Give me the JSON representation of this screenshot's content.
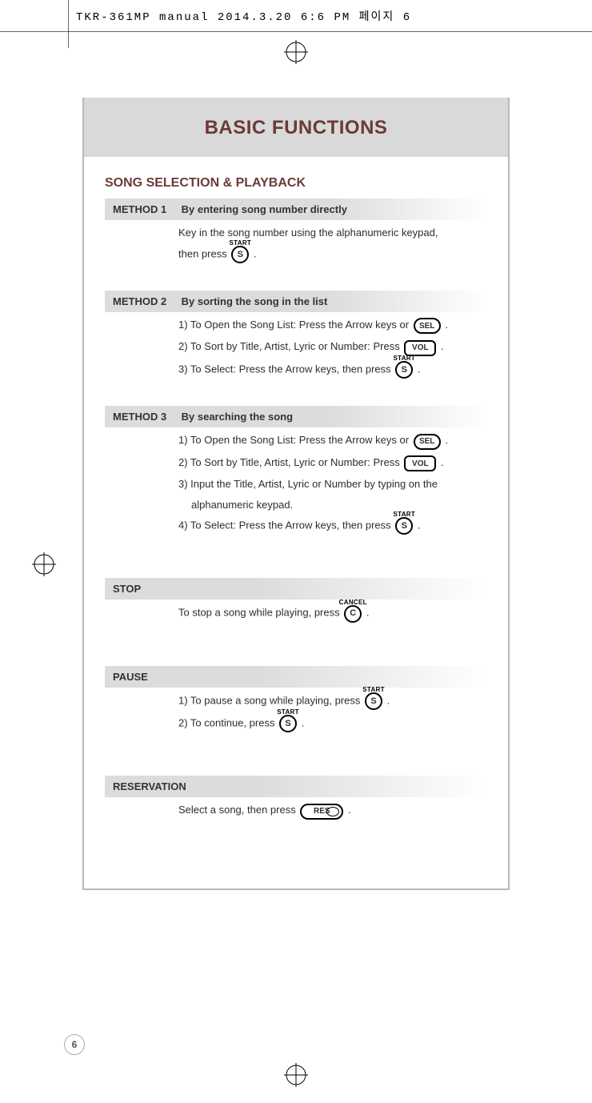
{
  "header": "TKR-361MP manual  2014.3.20  6:6 PM  페이지 6",
  "title": "BASIC FUNCTIONS",
  "section": "SONG SELECTION & PLAYBACK",
  "page_number": "6",
  "buttons": {
    "start": {
      "letter": "S",
      "label": "START"
    },
    "cancel": {
      "letter": "C",
      "label": "CANCEL"
    },
    "sel": "SEL",
    "vol": "VOL",
    "res": "RES"
  },
  "method1": {
    "tag": "METHOD 1",
    "heading": "By entering song number directly",
    "line1a": "Key in the song number using the alphanumeric keypad,",
    "line1b_pre": "then press ",
    "line1b_post": " ."
  },
  "method2": {
    "tag": "METHOD 2",
    "heading": "By sorting the song in the list",
    "l1_pre": "1) To Open the Song List: Press the Arrow keys or ",
    "l1_post": " .",
    "l2_pre": "2) To Sort by Title, Artist, Lyric or Number: Press ",
    "l2_post": " .",
    "l3_pre": "3) To Select: Press the Arrow keys, then press ",
    "l3_post": " ."
  },
  "method3": {
    "tag": "METHOD 3",
    "heading": "By searching the song",
    "l1_pre": "1) To Open the Song List: Press the Arrow keys or ",
    "l1_post": " .",
    "l2_pre": "2) To Sort by Title, Artist, Lyric or Number: Press ",
    "l2_post": " .",
    "l3": "3) Input the Title, Artist, Lyric or Number by typing on the",
    "l3b": "alphanumeric keypad.",
    "l4_pre": "4) To Select: Press the Arrow keys, then press ",
    "l4_post": " ."
  },
  "stop": {
    "heading": "STOP",
    "pre": "To stop a song while playing, press ",
    "post": " ."
  },
  "pause": {
    "heading": "PAUSE",
    "l1_pre": "1) To pause a song while playing, press ",
    "l1_post": " .",
    "l2_pre": "2) To continue, press ",
    "l2_post": " ."
  },
  "reservation": {
    "heading": "RESERVATION",
    "pre": "Select a song, then press ",
    "post": " ."
  }
}
